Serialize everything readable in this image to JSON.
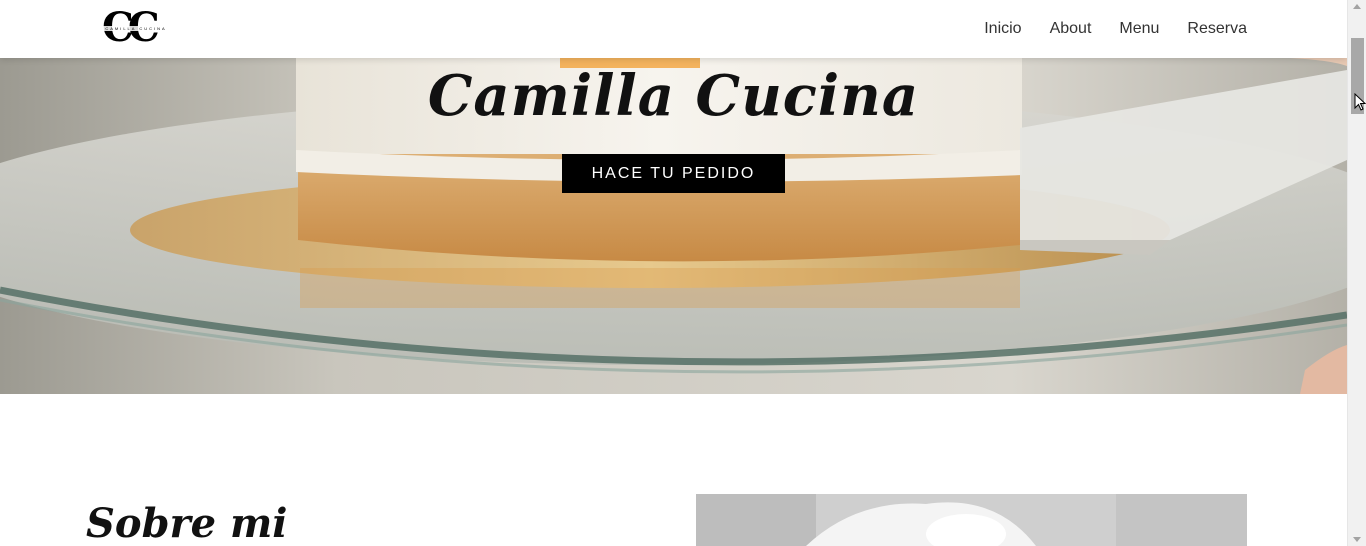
{
  "brand": {
    "monogram": "CC",
    "wordmark": "CAMILLA CUCINA"
  },
  "nav": {
    "items": [
      "Inicio",
      "About",
      "Menu",
      "Reserva"
    ]
  },
  "hero": {
    "title": "Camilla Cucina",
    "cta_label": "HACE TU PEDIDO"
  },
  "about": {
    "title": "Sobre mi"
  },
  "colors": {
    "header_bg": "#ffffff",
    "nav_text": "#333333",
    "cta_bg": "#000000",
    "cta_text": "#ffffff"
  }
}
